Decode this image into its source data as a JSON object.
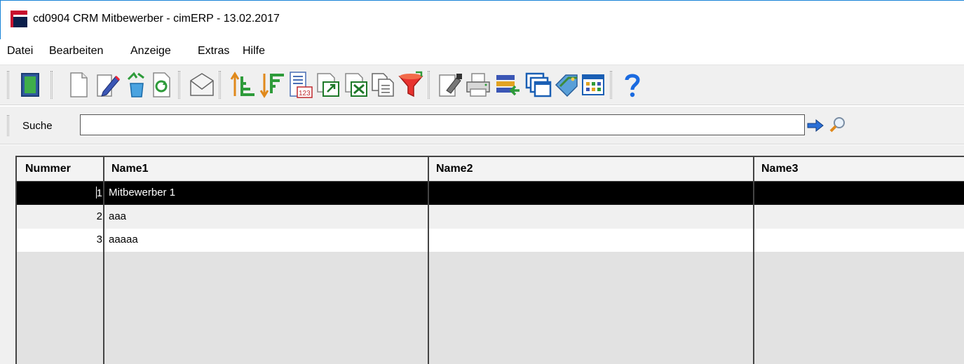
{
  "window": {
    "title": "cd0904 CRM Mitbewerber - cimERP - 13.02.2017"
  },
  "menu": [
    "Datei",
    "Bearbeiten",
    "Anzeige",
    "Extras",
    "Hilfe"
  ],
  "toolbar": {
    "buttons": [
      "exit-icon",
      "new-document-icon",
      "edit-icon",
      "recycle-delete-icon",
      "refresh-icon",
      "mail-icon",
      "sort-ascending-icon",
      "sort-descending-icon",
      "number-list-icon",
      "export-icon",
      "excel-export-icon",
      "copy-icon",
      "filter-icon",
      "properties-icon",
      "print-icon",
      "import-icon",
      "windows-icon",
      "tag-icon",
      "grid-view-icon",
      "help-icon"
    ]
  },
  "search": {
    "label": "Suche",
    "value": ""
  },
  "colors": {
    "selected_row": "#000000",
    "title_accent": "#c8102e"
  },
  "table": {
    "columns": [
      "Nummer",
      "Name1",
      "Name2",
      "Name3"
    ],
    "rows": [
      {
        "nummer": "1",
        "name1": "Mitbewerber 1",
        "name2": "",
        "name3": "",
        "selected": true
      },
      {
        "nummer": "2",
        "name1": "aaa",
        "name2": "",
        "name3": ""
      },
      {
        "nummer": "3",
        "name1": "aaaaa",
        "name2": "",
        "name3": ""
      }
    ]
  }
}
